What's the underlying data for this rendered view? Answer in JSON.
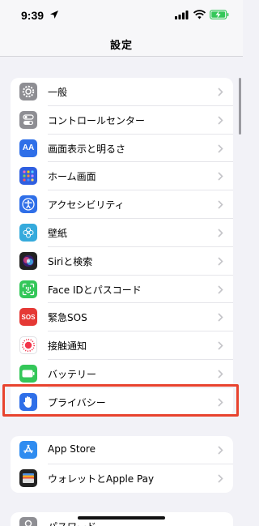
{
  "status_bar": {
    "time": "9:39",
    "icons": [
      "location-arrow-icon",
      "signal-icon",
      "wifi-icon",
      "battery-charging-icon"
    ],
    "battery_color": "#34c759"
  },
  "nav": {
    "title": "設定"
  },
  "group1": [
    {
      "label": "一般",
      "icon": "gear-icon",
      "color": "#8e8e93"
    },
    {
      "label": "コントロールセンター",
      "icon": "toggle-icon",
      "color": "#8e8e93"
    },
    {
      "label": "画面表示と明るさ",
      "icon": "text-size-icon",
      "glyph": "AA",
      "color": "#2f6fe8"
    },
    {
      "label": "ホーム画面",
      "icon": "home-grid-icon",
      "color": "#2f5fe0"
    },
    {
      "label": "アクセシビリティ",
      "icon": "accessibility-icon",
      "color": "#2f6fe8"
    },
    {
      "label": "壁紙",
      "icon": "wallpaper-flower-icon",
      "color": "#35aadc"
    },
    {
      "label": "Siriと検索",
      "icon": "siri-icon",
      "color": "#222222"
    },
    {
      "label": "Face IDとパスコード",
      "icon": "face-id-icon",
      "color": "#34c759"
    },
    {
      "label": "緊急SOS",
      "icon": "sos-icon",
      "glyph": "SOS",
      "color": "#e53935"
    },
    {
      "label": "接触通知",
      "icon": "exposure-notification-icon",
      "color": "#ffffff"
    },
    {
      "label": "バッテリー",
      "icon": "battery-icon",
      "color": "#34c759"
    },
    {
      "label": "プライバシー",
      "icon": "hand-icon",
      "color": "#2f6fe8"
    }
  ],
  "group2": [
    {
      "label": "App Store",
      "icon": "app-store-icon",
      "color": "#2f8cf0"
    },
    {
      "label": "ウォレットとApple Pay",
      "icon": "wallet-icon",
      "color": "#222222"
    }
  ],
  "group3": [
    {
      "label": "パスワード",
      "icon": "key-icon",
      "color": "#8e8e93"
    }
  ],
  "highlight_color": "#e8432e"
}
